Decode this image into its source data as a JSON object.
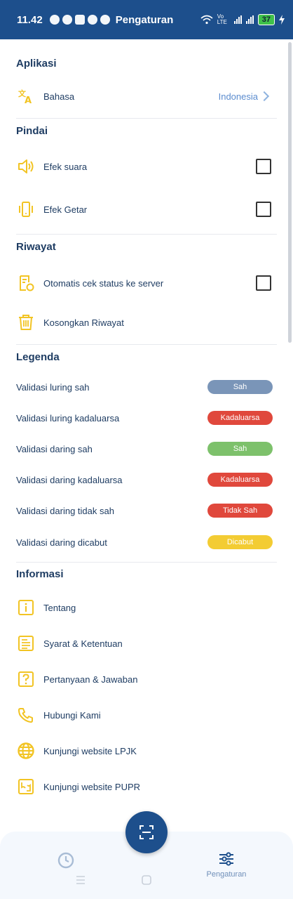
{
  "status_bar": {
    "time": "11.42",
    "title": "Pengaturan",
    "net_label": "Vo LTE",
    "battery": "37"
  },
  "colors": {
    "primary": "#1d4f8c",
    "icon_yellow": "#f2c424",
    "sah_offline": "#7a95b8",
    "kadaluarsa": "#e0483c",
    "sah_online": "#7dc16b",
    "tidak_sah": "#e0483c",
    "dicabut": "#f3cc33"
  },
  "aplikasi": {
    "title": "Aplikasi",
    "bahasa_label": "Bahasa",
    "bahasa_value": "Indonesia"
  },
  "pindai": {
    "title": "Pindai",
    "efek_suara": "Efek suara",
    "efek_getar": "Efek Getar"
  },
  "riwayat": {
    "title": "Riwayat",
    "otomatis": "Otomatis cek status ke server",
    "kosongkan": "Kosongkan Riwayat"
  },
  "legenda": {
    "title": "Legenda",
    "items": [
      {
        "label": "Validasi luring sah",
        "badge": "Sah"
      },
      {
        "label": "Validasi luring kadaluarsa",
        "badge": "Kadaluarsa"
      },
      {
        "label": "Validasi daring sah",
        "badge": "Sah"
      },
      {
        "label": "Validasi daring kadaluarsa",
        "badge": "Kadaluarsa"
      },
      {
        "label": "Validasi daring tidak sah",
        "badge": "Tidak Sah"
      },
      {
        "label": "Validasi daring dicabut",
        "badge": "Dicabut"
      }
    ]
  },
  "informasi": {
    "title": "Informasi",
    "items": [
      {
        "label": "Tentang",
        "icon": "info-icon"
      },
      {
        "label": "Syarat & Ketentuan",
        "icon": "document-icon"
      },
      {
        "label": "Pertanyaan & Jawaban",
        "icon": "question-icon"
      },
      {
        "label": "Hubungi Kami",
        "icon": "phone-icon"
      },
      {
        "label": "Kunjungi website LPJK",
        "icon": "globe-icon"
      },
      {
        "label": "Kunjungi website PUPR",
        "icon": "map-icon"
      }
    ]
  },
  "bottom_nav": {
    "settings_label": "Pengaturan"
  }
}
